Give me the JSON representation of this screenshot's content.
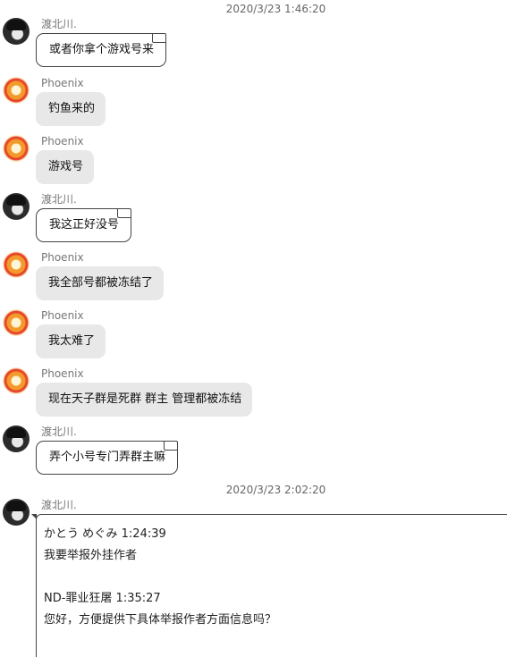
{
  "timestamps": [
    "2020/3/23 1:46:20",
    "2020/3/23 2:02:20"
  ],
  "messages": [
    {
      "sender": "渡北川.",
      "text": "或者你拿个游戏号来"
    },
    {
      "sender": "Phoenix",
      "text": "钓鱼来的"
    },
    {
      "sender": "Phoenix",
      "text": "游戏号"
    },
    {
      "sender": "渡北川.",
      "text": "我这正好没号"
    },
    {
      "sender": "Phoenix",
      "text": "我全部号都被冻结了"
    },
    {
      "sender": "Phoenix",
      "text": "我太难了"
    },
    {
      "sender": "Phoenix",
      "text": "现在天子群是死群 群主 管理都被冻结"
    },
    {
      "sender": "渡北川.",
      "text": "弄个小号专门弄群主嘛"
    }
  ],
  "forwarded": {
    "sender": "渡北川.",
    "lines": [
      "かとう めぐみ 1:24:39",
      "我要举报外挂作者",
      "",
      "ND-罪业狂屠 1:35:27",
      "您好，方便提供下具体举报作者方面信息吗？"
    ]
  },
  "avatars": {
    "渡北川.": "dark-anime-avatar",
    "Phoenix": "phoenix-avatar"
  }
}
